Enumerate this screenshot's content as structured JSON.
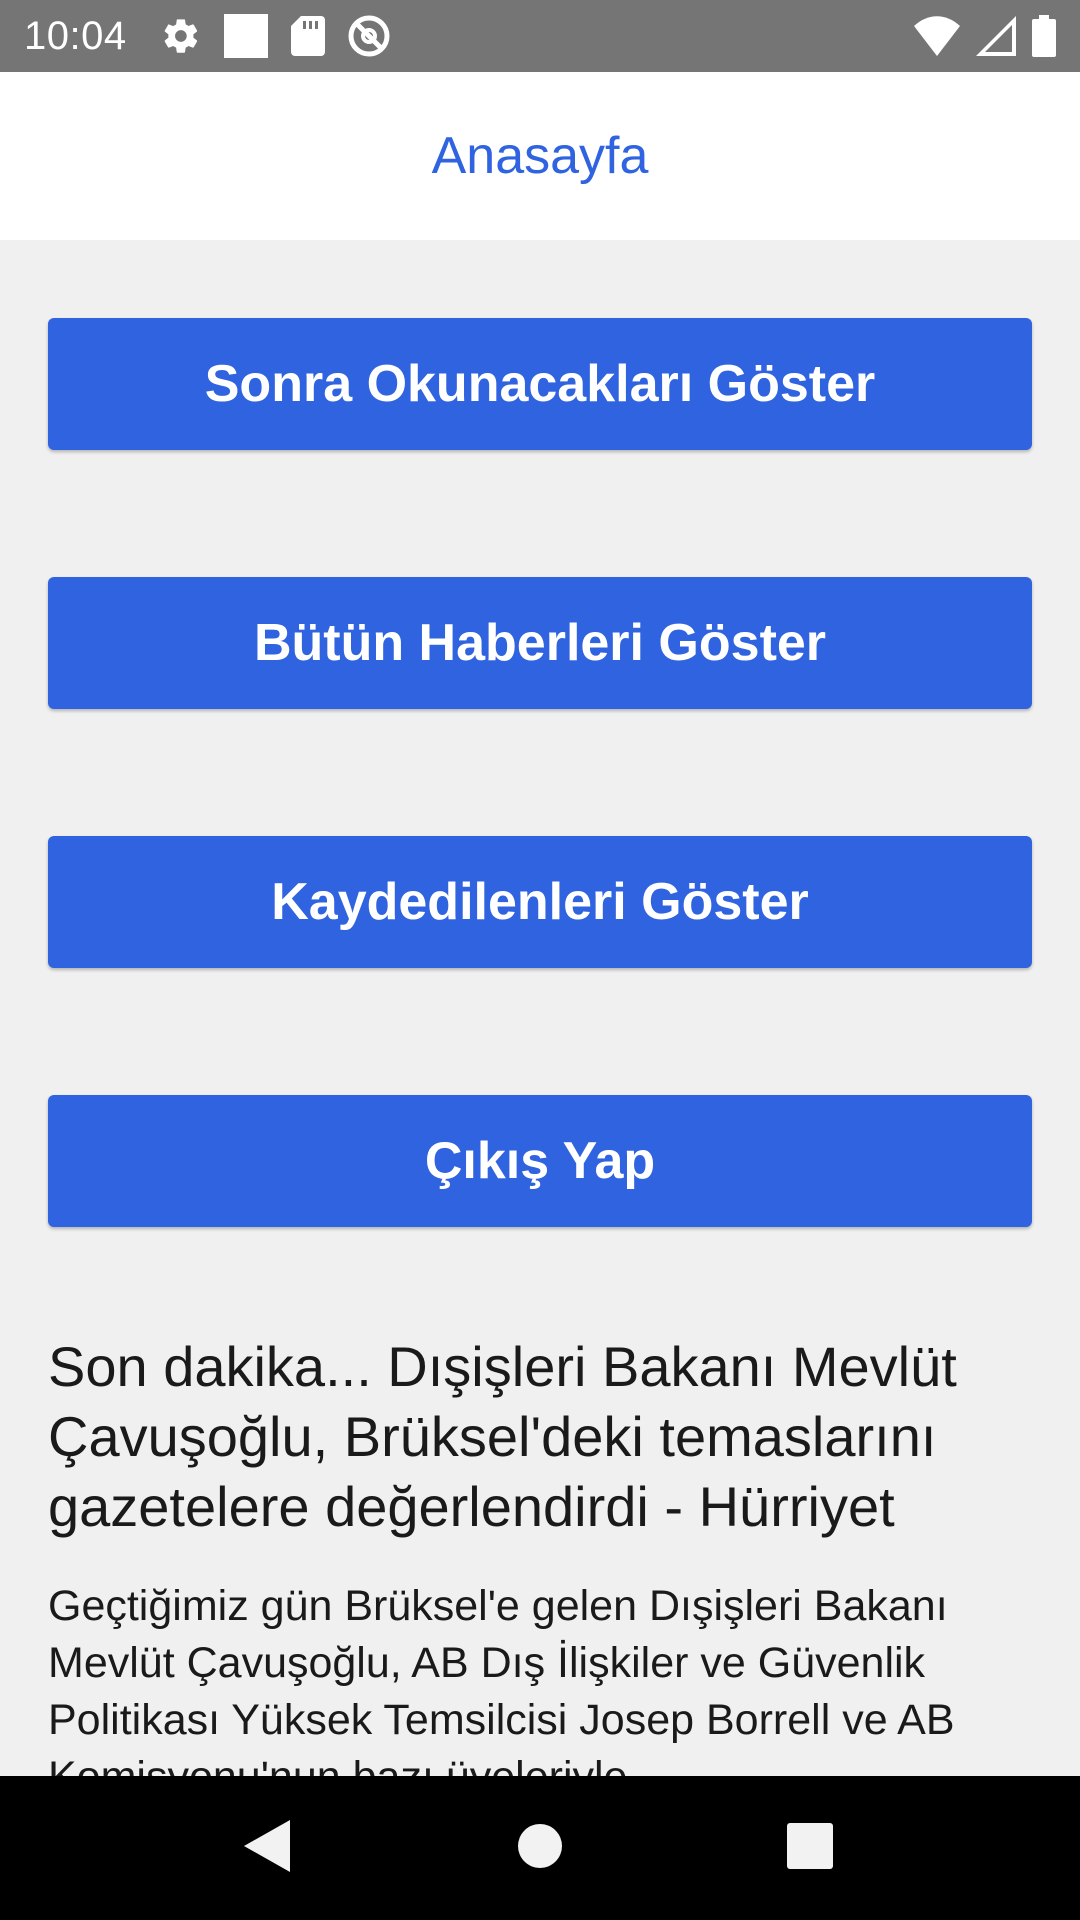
{
  "status_bar": {
    "time": "10:04",
    "icons_left": [
      "settings-gear-icon",
      "square-notification-icon",
      "sd-card-icon",
      "do-not-disturb-icon"
    ],
    "icons_right": [
      "wifi-icon",
      "cellular-signal-icon",
      "battery-icon"
    ]
  },
  "header": {
    "title": "Anasayfa"
  },
  "buttons": {
    "read_later": "Sonra Okunacakları Göster",
    "all_news": "Bütün Haberleri Göster",
    "saved": "Kaydedilenleri Göster",
    "logout": "Çıkış Yap"
  },
  "news": {
    "headline": "Son dakika... Dışişleri Bakanı Mevlüt Çavuşoğlu, Brüksel'deki temaslarını gazetelere değerlendirdi - Hürriyet",
    "summary": "Geçtiğimiz gün Brüksel'e gelen Dışişleri Bakanı Mevlüt Çavuşoğlu, AB Dış İlişkiler ve Güvenlik Politikası Yüksek Temsilcisi Josep Borrell ve AB Komisyonu'nun bazı üyeleriyle"
  },
  "navigation": {
    "icons": [
      "back-icon",
      "home-icon",
      "recents-icon"
    ]
  },
  "colors": {
    "accent": "#3063e0",
    "status_bar": "#757575",
    "background": "#f0f0f0"
  }
}
